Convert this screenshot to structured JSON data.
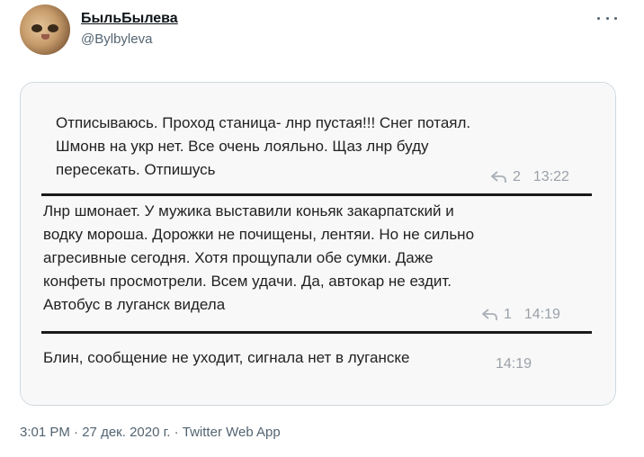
{
  "author": {
    "display_name": "БыльБылева",
    "handle": "@Bylbyleva"
  },
  "screenshot": {
    "messages": [
      {
        "lines": [
          "Отписываюсь. Проход станица- лнр пустая!!! Снег потаял.",
          "Шмонв на укр нет. Все очень лояльно. Щаз лнр буду",
          "пересекать. Отпишусь"
        ],
        "reply_count": "2",
        "time": "13:22"
      },
      {
        "lines": [
          "Лнр шмонает. У мужика выставили коньяк закарпатский и",
          "водку мороша. Дорожки не почищены, лентяи. Но не сильно",
          "агресивные сегодня. Хотя прощупали обе сумки. Даже",
          "конфеты просмотрели. Всем удачи. Да, автокар не ездит.",
          "Автобус в луганск видела"
        ],
        "reply_count": "1",
        "time": "14:19"
      },
      {
        "lines": [
          "Блин, сообщение не уходит, сигнала нет в луганске"
        ],
        "time": "14:19"
      }
    ]
  },
  "footer": {
    "time": "3:01 PM",
    "separator": " · ",
    "date": "27 дек. 2020 г.",
    "source": "Twitter Web App"
  }
}
